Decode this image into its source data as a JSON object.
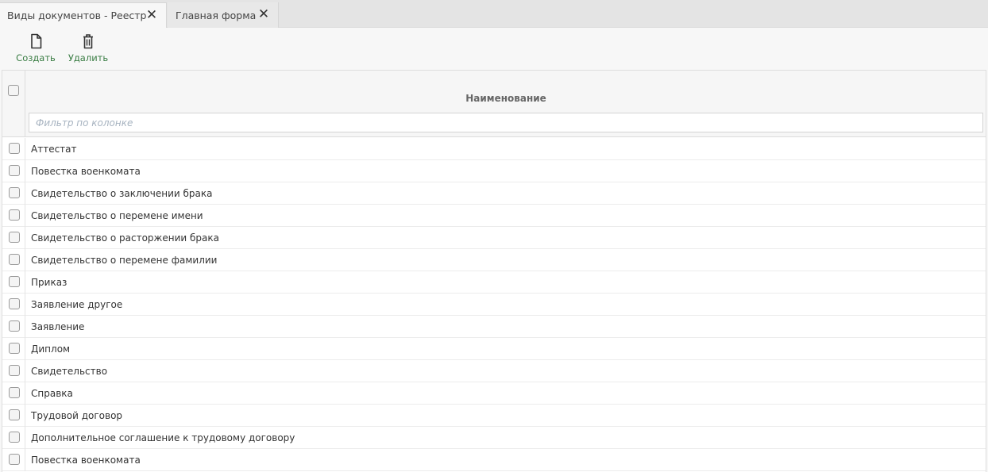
{
  "tabs": [
    {
      "label": "Виды документов - Реестр",
      "active": true,
      "close_icon": "close-icon"
    },
    {
      "label": "Главная форма",
      "active": false,
      "close_icon": "close-icon"
    }
  ],
  "toolbar": {
    "create_label": "Создать",
    "create_icon": "document-icon",
    "delete_label": "Удалить",
    "delete_icon": "trash-icon",
    "accent_color": "#3a7d44"
  },
  "grid": {
    "column_header": "Наименование",
    "filter_placeholder": "Фильтр по колонке",
    "filter_value": "",
    "rows": [
      "Аттестат",
      "Повестка военкомата",
      "Свидетельство о заключении брака",
      "Свидетельство о перемене имени",
      "Свидетельство о расторжении брака",
      "Свидетельство о перемене фамилии",
      "Приказ",
      "Заявление другое",
      "Заявление",
      "Диплом",
      "Свидетельство",
      "Справка",
      "Трудовой договор",
      "Дополнительное соглашение к трудовому договору",
      "Повестка военкомата"
    ]
  }
}
